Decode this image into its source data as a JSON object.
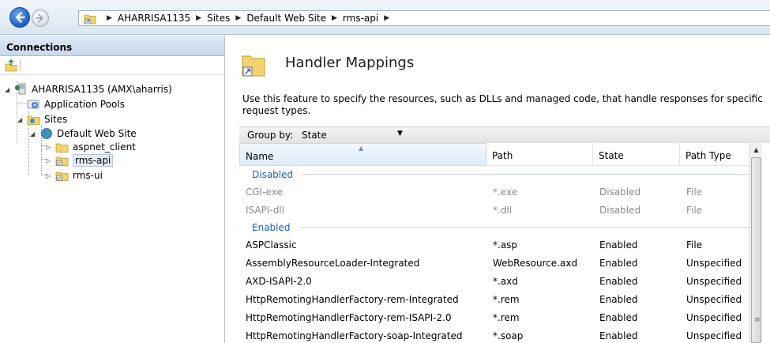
{
  "breadcrumbs": [
    "AHARRISA1135",
    "Sites",
    "Default Web Site",
    "rms-api"
  ],
  "connections": {
    "title": "Connections",
    "tree": {
      "server": "AHARRISA1135 (AMX\\aharris)",
      "app_pools": "Application Pools",
      "sites": "Sites",
      "default_site": "Default Web Site",
      "children": [
        "aspnet_client",
        "rms-api",
        "rms-ui"
      ]
    }
  },
  "feature": {
    "title": "Handler Mappings",
    "description": "Use this feature to specify the resources, such as DLLs and managed code, that handle responses for specific request types.",
    "group_by_label": "Group by:",
    "group_by_value": "State"
  },
  "grid": {
    "columns": [
      "Name",
      "Path",
      "State",
      "Path Type"
    ],
    "groups": [
      {
        "label": "Disabled",
        "rows": [
          [
            "CGI-exe",
            "*.exe",
            "Disabled",
            "File"
          ],
          [
            "ISAPI-dll",
            "*.dll",
            "Disabled",
            "File"
          ]
        ]
      },
      {
        "label": "Enabled",
        "rows": [
          [
            "ASPClassic",
            "*.asp",
            "Enabled",
            "File"
          ],
          [
            "AssemblyResourceLoader-Integrated",
            "WebResource.axd",
            "Enabled",
            "Unspecified"
          ],
          [
            "AXD-ISAPI-2.0",
            "*.axd",
            "Enabled",
            "Unspecified"
          ],
          [
            "HttpRemotingHandlerFactory-rem-Integrated",
            "*.rem",
            "Enabled",
            "Unspecified"
          ],
          [
            "HttpRemotingHandlerFactory-rem-ISAPI-2.0",
            "*.rem",
            "Enabled",
            "Unspecified"
          ],
          [
            "HttpRemotingHandlerFactory-soap-Integrated",
            "*.soap",
            "Enabled",
            "Unspecified"
          ]
        ]
      }
    ]
  },
  "colors": {
    "group_header": "#1e5fb6",
    "disabled_text": "#8c8c8c",
    "selection": "#e5ecf5"
  }
}
